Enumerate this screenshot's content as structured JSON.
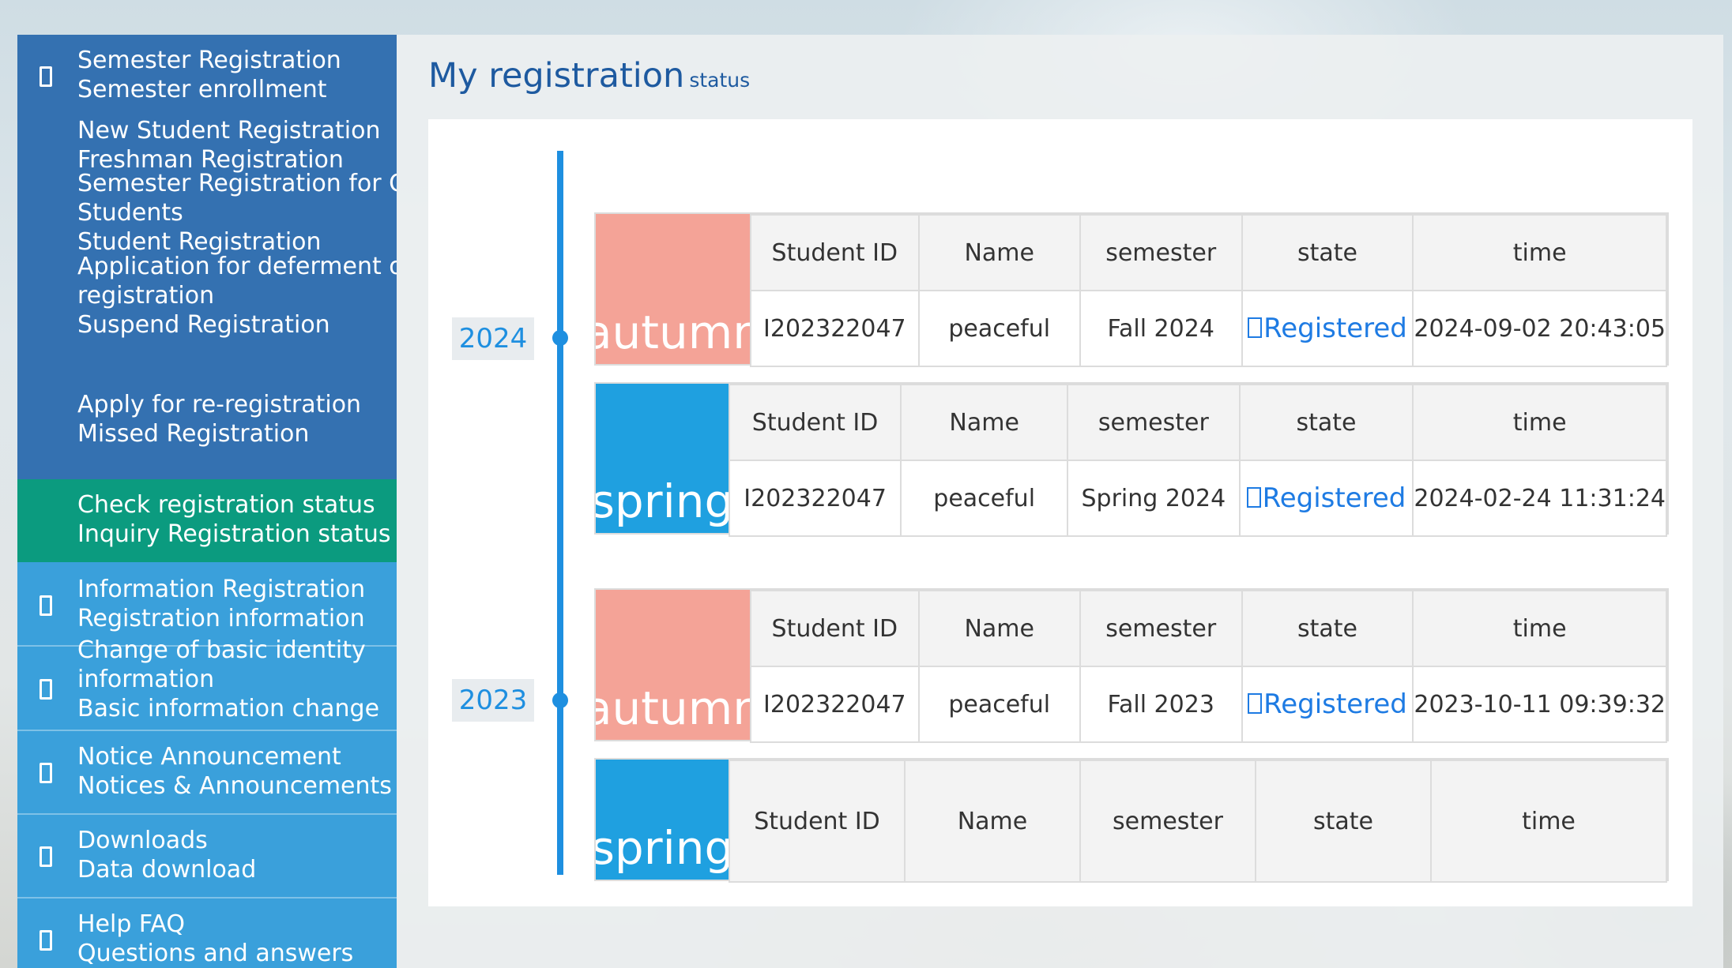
{
  "sidebar": {
    "items": [
      {
        "lines": [
          "Semester Registration",
          "Semester enrollment"
        ]
      },
      {
        "lines": [
          "New Student Registration",
          "Freshman Registration",
          "Semester Registration for Old",
          "Students",
          "Student Registration",
          "Application for deferment of",
          "registration",
          "Suspend Registration"
        ]
      },
      {
        "lines": [
          "Apply for re-registration",
          "Missed Registration"
        ]
      },
      {
        "lines": [
          "Check registration status",
          "Inquiry Registration status"
        ]
      },
      {
        "lines": [
          "Information Registration",
          "Registration information"
        ]
      },
      {
        "lines": [
          "Change of basic identity",
          "information",
          "Basic information change"
        ]
      },
      {
        "lines": [
          "Notice Announcement",
          "Notices & Announcements"
        ]
      },
      {
        "lines": [
          "Downloads",
          "Data download"
        ]
      },
      {
        "lines": [
          "Help FAQ",
          "Questions and answers"
        ]
      }
    ]
  },
  "main": {
    "title": "My registration",
    "subtitle": "status",
    "years": [
      "2024",
      "2023"
    ],
    "headers": {
      "student_id": "Student ID",
      "name": "Name",
      "semester": "semester",
      "state": "state",
      "time": "time"
    },
    "records": [
      {
        "season": "autumn",
        "student_id": "I202322047",
        "name": "peaceful",
        "semester": "Fall 2024",
        "state": "Registered",
        "time": "2024-09-02 20:43:05"
      },
      {
        "season": "spring",
        "student_id": "I202322047",
        "name": "peaceful",
        "semester": "Spring 2024",
        "state": "Registered",
        "time": "2024-02-24 11:31:24"
      },
      {
        "season": "autumn",
        "student_id": "I202322047",
        "name": "peaceful",
        "semester": "Fall 2023",
        "state": "Registered",
        "time": "2023-10-11 09:39:32"
      },
      {
        "season": "spring"
      }
    ]
  },
  "colors": {
    "sidebar_dark": "#3471b1",
    "sidebar_light": "#3aa0db",
    "sidebar_active": "#0b9b7f",
    "autumn": "#f4a397",
    "spring": "#1fa0e0",
    "accent": "#1e8fe0"
  },
  "icons": {
    "menu_icon": "document-icon",
    "state_icon": "check-icon"
  }
}
